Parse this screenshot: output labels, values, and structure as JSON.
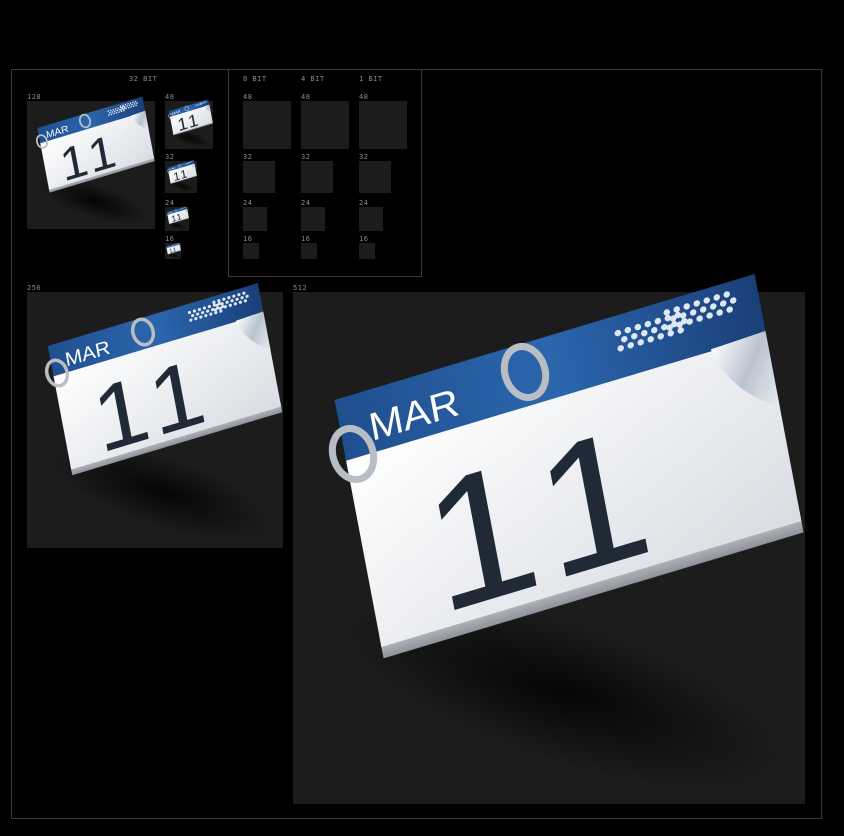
{
  "headers": {
    "bit32": "32 BIT",
    "bit8": "8 BIT",
    "bit4": "4 BIT",
    "bit1": "1 BIT"
  },
  "sizes": {
    "s128": "128",
    "s48": "48",
    "s32": "32",
    "s24": "24",
    "s16": "16",
    "s256": "256",
    "s512": "512"
  },
  "calendar": {
    "month": "MAR",
    "day": "11"
  },
  "colors": {
    "background": "#000000",
    "tile": "#1c1c1c",
    "frame": "#3a3a3a",
    "header_blue": "#2a63a8",
    "digit": "#1f2a36",
    "page": "#eef0f3"
  }
}
